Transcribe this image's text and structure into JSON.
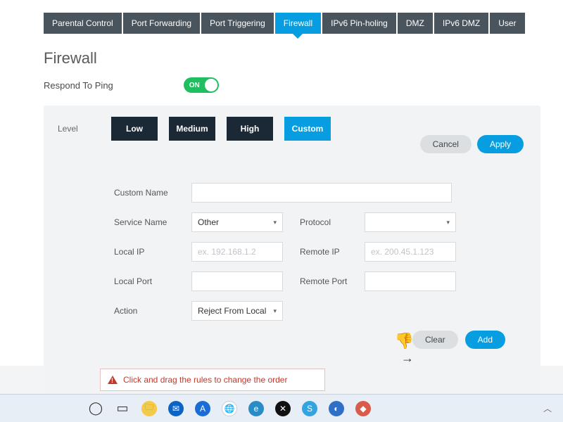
{
  "tabs": [
    "Parental Control",
    "Port Forwarding",
    "Port Triggering",
    "Firewall",
    "IPv6 Pin-holing",
    "DMZ",
    "IPv6 DMZ",
    "User"
  ],
  "active_tab_index": 3,
  "page_title": "Firewall",
  "ping": {
    "label": "Respond To Ping",
    "toggle_text": "ON"
  },
  "level": {
    "label": "Level",
    "options": [
      "Low",
      "Medium",
      "High",
      "Custom"
    ],
    "active_index": 3,
    "cancel": "Cancel",
    "apply": "Apply"
  },
  "form": {
    "custom_name": {
      "label": "Custom Name",
      "value": ""
    },
    "service_name": {
      "label": "Service Name",
      "value": "Other"
    },
    "protocol": {
      "label": "Protocol",
      "value": ""
    },
    "local_ip": {
      "label": "Local IP",
      "placeholder": "ex. 192.168.1.2",
      "value": ""
    },
    "remote_ip": {
      "label": "Remote IP",
      "placeholder": "ex. 200.45.1.123",
      "value": ""
    },
    "local_port": {
      "label": "Local Port",
      "value": ""
    },
    "remote_port": {
      "label": "Remote Port",
      "value": ""
    },
    "action": {
      "label": "Action",
      "value": "Reject From Local"
    },
    "clear": "Clear",
    "add": "Add"
  },
  "info_text": "Click and drag the rules to change the order",
  "tray_chevron": "︿"
}
